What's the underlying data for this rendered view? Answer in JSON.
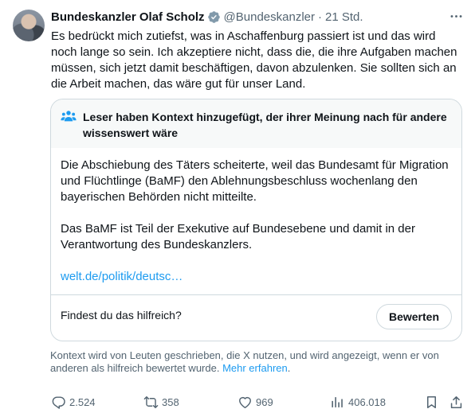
{
  "author": {
    "name": "Bundeskanzler Olaf Scholz",
    "handle": "@Bundeskanzler",
    "separator": "·",
    "time": "21 Std."
  },
  "tweet": {
    "text": "Es bedrückt mich zutiefst, was in Aschaffenburg passiert ist und das wird noch lange so sein. Ich akzeptiere nicht, dass die, die ihre Aufgaben machen müssen, sich jetzt damit beschäftigen, davon abzulenken. Sie sollten sich an die Arbeit machen, das wäre gut für unser Land."
  },
  "community_note": {
    "title": "Leser haben Kontext hinzugefügt, der ihrer Meinung nach für andere wissenswert wäre",
    "paragraph1": "Die Abschiebung des Täters scheiterte, weil das Bundesamt für Migration und Flüchtlinge (BaMF) den Ablehnungsbeschluss wochenlang den bayerischen Behörden nicht mitteilte.",
    "paragraph2": "Das BaMF ist Teil der Exekutive auf Bundesebene und damit in der Verantwortung des Bundeskanzlers.",
    "link_text": "welt.de/politik/deutsc…",
    "helpful_question": "Findest du das hilfreich?",
    "rate_button": "Bewerten"
  },
  "context_info": {
    "text": "Kontext wird von Leuten geschrieben, die X nutzen, und wird angezeigt, wenn er von anderen als hilfreich bewertet wurde.",
    "more_link": "Mehr erfahren",
    "end": "."
  },
  "actions": {
    "replies": "2.524",
    "reposts": "358",
    "likes": "969",
    "views": "406.018"
  },
  "icons": {
    "verified": "verified-badge-icon",
    "more": "more-dots-icon",
    "note": "people-icon",
    "reply": "reply-icon",
    "repost": "repost-icon",
    "like": "heart-icon",
    "views": "views-icon",
    "bookmark": "bookmark-icon",
    "share": "share-icon"
  },
  "colors": {
    "accent": "#1d9bf0",
    "text": "#0f1419",
    "muted": "#536471",
    "border": "#cfd9de",
    "note_header_bg": "#f7f9f9"
  }
}
